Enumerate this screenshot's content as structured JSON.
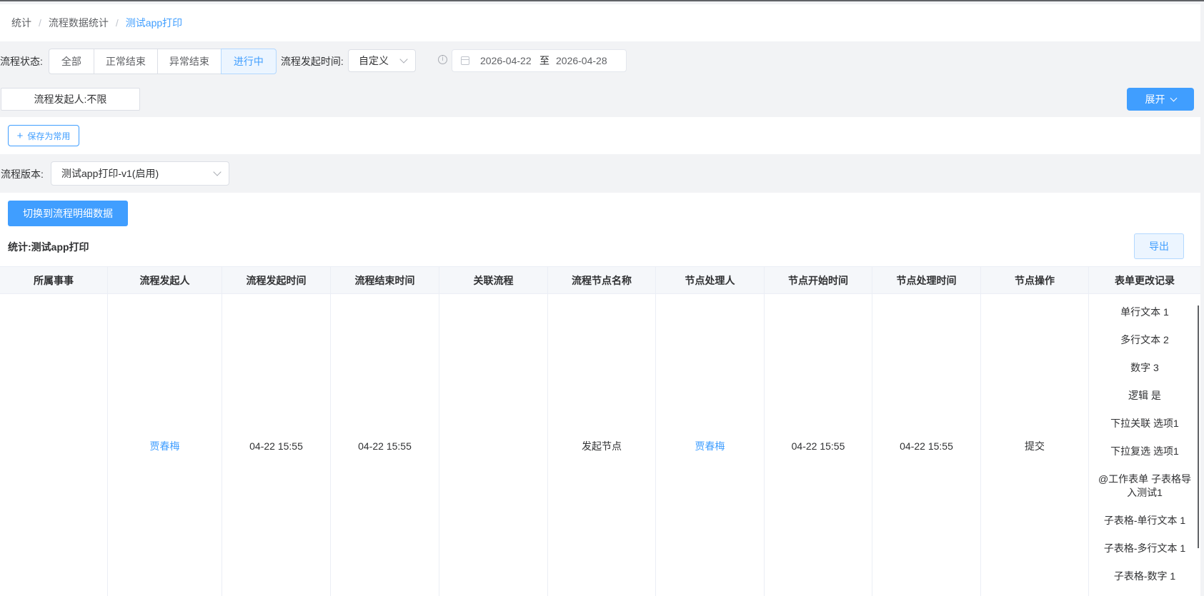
{
  "breadcrumb": {
    "items": [
      "统计",
      "流程数据统计"
    ],
    "separator": "/",
    "current": "测试app打印"
  },
  "filters": {
    "status_label": "流程状态:",
    "status_options": [
      "全部",
      "正常结束",
      "异常结束",
      "进行中"
    ],
    "status_selected": "进行中",
    "time_label": "流程发起时间:",
    "time_mode": "自定义",
    "date_start": "2026-04-22",
    "date_sep": "至",
    "date_end": "2026-04-28",
    "initiator": "流程发起人:不限",
    "expand_label": "展开"
  },
  "save_common_label": "保存为常用",
  "version": {
    "label": "流程版本:",
    "value": "测试app打印-v1(启用)"
  },
  "switch_button": "切换到流程明细数据",
  "stat_title": "统计:测试app打印",
  "export_label": "导出",
  "table": {
    "headers": [
      "所属事事",
      "流程发起人",
      "流程发起时间",
      "流程结束时间",
      "关联流程",
      "流程节点名称",
      "节点处理人",
      "节点开始时间",
      "节点处理时间",
      "节点操作",
      "表单更改记录"
    ],
    "row": {
      "matter": "",
      "initiator": "贾春梅",
      "start_time": "04-22 15:55",
      "end_time": "04-22 15:55",
      "related": "",
      "node_name": "发起节点",
      "handler": "贾春梅",
      "node_start": "04-22 15:55",
      "node_handle": "04-22 15:55",
      "operation": "提交",
      "changes": [
        "单行文本 1",
        "多行文本 2",
        "数字 3",
        "逻辑 是",
        "下拉关联 选项1",
        "下拉复选 选项1",
        "@工作表单 子表格导入测试1",
        "子表格-单行文本 1",
        "子表格-多行文本 1",
        "子表格-数字 1"
      ]
    }
  },
  "colors": {
    "accent": "#409eff",
    "background": "#f2f3f5",
    "active_bg": "#ecf5ff"
  }
}
